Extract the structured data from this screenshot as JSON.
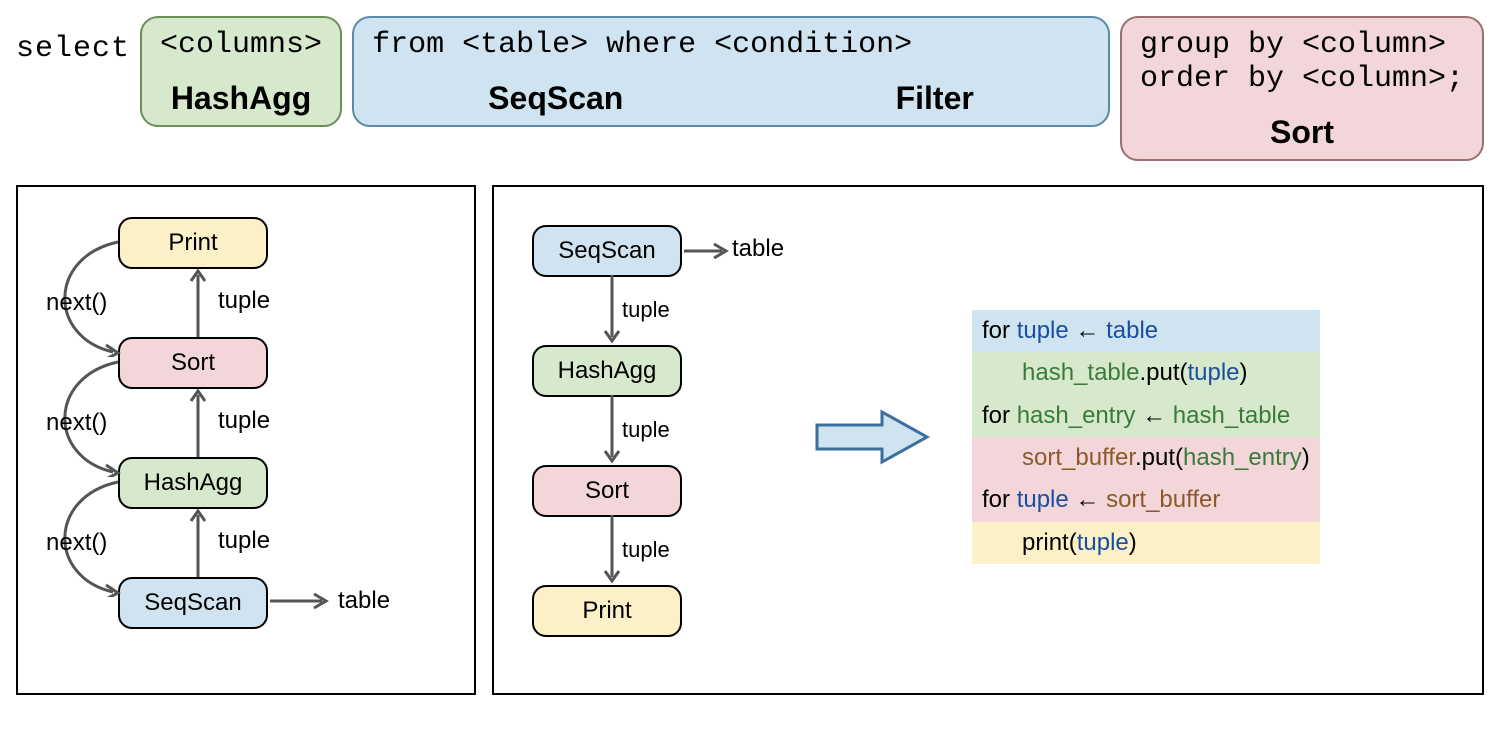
{
  "sql": {
    "select": "select",
    "columns_box": {
      "text": "<columns>",
      "label": "HashAgg"
    },
    "from_box": {
      "text": "from <table> where <condition>",
      "labels": [
        "SeqScan",
        "Filter"
      ]
    },
    "sort_box": {
      "line1": "group by <column>",
      "line2": "order by <column>;",
      "label": "Sort"
    }
  },
  "left": {
    "stages": {
      "print": "Print",
      "sort": "Sort",
      "hashagg": "HashAgg",
      "seqscan": "SeqScan"
    },
    "edge_up": "tuple",
    "edge_down": "next()",
    "seq_to_table": "table"
  },
  "right": {
    "stages": {
      "seqscan": "SeqScan",
      "hashagg": "HashAgg",
      "sort": "Sort",
      "print": "Print"
    },
    "edge": "tuple",
    "seq_to_table": "table"
  },
  "pseudo": {
    "for": "for ",
    "arrow": " ← ",
    "tuple": "tuple",
    "table": "table",
    "hash_table": "hash_table",
    "hash_entry": "hash_entry",
    "sort_buffer": "sort_buffer",
    "put_open": ".put(",
    "close_paren": ")",
    "print_open": "print(",
    "indent": "      "
  }
}
